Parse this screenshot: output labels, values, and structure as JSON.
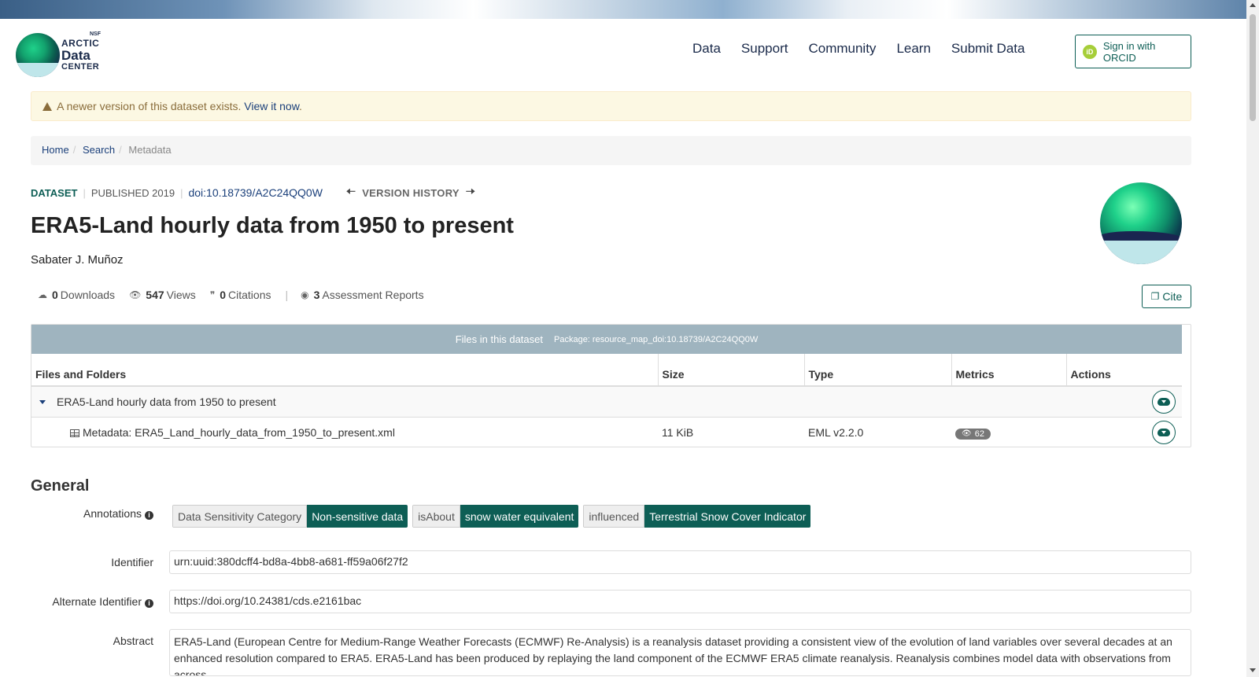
{
  "header": {
    "logo": {
      "nsf": "NSF",
      "line1": "ARCTIC",
      "line2": "Data",
      "line3": "CENTER"
    },
    "nav": [
      "Data",
      "Support",
      "Community",
      "Learn",
      "Submit Data"
    ],
    "orcid_button": "Sign in with ORCID",
    "orcid_icon_text": "iD"
  },
  "alert": {
    "text": "A newer version of this dataset exists.",
    "link": "View it now",
    "period": "."
  },
  "breadcrumb": {
    "home": "Home",
    "search": "Search",
    "current": "Metadata"
  },
  "dataset": {
    "type_label": "DATASET",
    "published": "PUBLISHED 2019",
    "doi": "doi:10.18739/A2C24QQ0W",
    "version_history": "VERSION HISTORY",
    "title": "ERA5-Land hourly data from 1950 to present",
    "author": "Sabater J. Muñoz"
  },
  "stats": {
    "downloads_count": "0",
    "downloads_label": "Downloads",
    "views_count": "547",
    "views_label": "Views",
    "citations_count": "0",
    "citations_label": "Citations",
    "reports_count": "3",
    "reports_label": "Assessment Reports"
  },
  "cite_button": "Cite",
  "files": {
    "heading": "Files in this dataset",
    "package": "Package: resource_map_doi:10.18739/A2C24QQ0W",
    "columns": [
      "Files and Folders",
      "Size",
      "Type",
      "Metrics",
      "Actions"
    ],
    "folder_name": "ERA5-Land hourly data from 1950 to present",
    "file": {
      "name": "Metadata: ERA5_Land_hourly_data_from_1950_to_present.xml",
      "size": "11 KiB",
      "type": "EML v2.2.0",
      "views": "62"
    }
  },
  "general": {
    "heading": "General",
    "annotations_label": "Annotations",
    "annotations": [
      {
        "key": "Data Sensitivity Category",
        "value": "Non-sensitive data"
      },
      {
        "key": "isAbout",
        "value": "snow water equivalent"
      },
      {
        "key": "influenced",
        "value": "Terrestrial Snow Cover Indicator"
      }
    ],
    "identifier_label": "Identifier",
    "identifier": "urn:uuid:380dcff4-bd8a-4bb8-a681-ff59a06f27f2",
    "alt_identifier_label": "Alternate Identifier",
    "alt_identifier": "https://doi.org/10.24381/cds.e2161bac",
    "abstract_label": "Abstract",
    "abstract": "ERA5-Land (European Centre for Medium-Range Weather Forecasts (ECMWF) Re-Analysis) is a reanalysis dataset providing a consistent view of the evolution of land variables over several decades at an enhanced resolution compared to ERA5. ERA5-Land has been produced by replaying the land component of the ECMWF ERA5 climate reanalysis. Reanalysis combines model data with observations from across"
  },
  "colors": {
    "accent": "#0d5e55",
    "link": "#1a3f7a",
    "alert_bg": "#fcf8e3",
    "files_header": "#9fb4bf"
  }
}
